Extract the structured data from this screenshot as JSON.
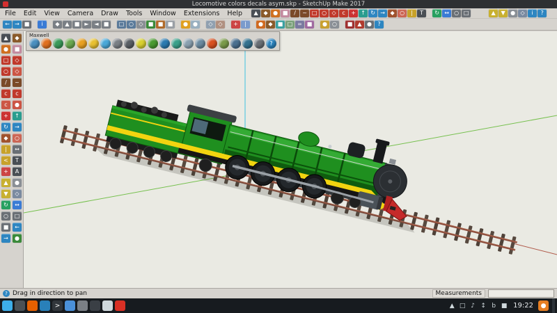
{
  "title_bar": {
    "title": "Locomotive colors decals asym.skp - SketchUp Make 2017"
  },
  "menu_bar": {
    "items": [
      "File",
      "Edit",
      "View",
      "Camera",
      "Draw",
      "Tools",
      "Window",
      "Extensions",
      "Help"
    ]
  },
  "toolbar_row1": {
    "icons": [
      {
        "name": "select-tool-icon",
        "glyph": "▲",
        "color": "#4a4f55"
      },
      {
        "name": "make-component-icon",
        "glyph": "◆",
        "color": "#8a5a2a"
      },
      {
        "name": "paint-bucket-icon",
        "glyph": "●",
        "color": "#d07020"
      },
      {
        "name": "eraser-icon",
        "glyph": "■",
        "color": "#c48ca0"
      },
      {
        "name": "line-tool-icon",
        "glyph": "/",
        "color": "#7a4a28"
      },
      {
        "name": "freehand-tool-icon",
        "glyph": "~",
        "color": "#7a4a28"
      },
      {
        "name": "rectangle-tool-icon",
        "glyph": "□",
        "color": "#c0392b"
      },
      {
        "name": "circle-tool-icon",
        "glyph": "○",
        "color": "#c0392b"
      },
      {
        "name": "polygon-tool-icon",
        "glyph": "◇",
        "color": "#c0392b"
      },
      {
        "name": "arc-tool-icon",
        "glyph": "c",
        "color": "#c0392b"
      },
      {
        "name": "move-tool-icon",
        "glyph": "+",
        "color": "#cc3333"
      },
      {
        "name": "push-pull-tool-icon",
        "glyph": "↑",
        "color": "#2a9d8f"
      },
      {
        "name": "rotate-tool-icon",
        "glyph": "↻",
        "color": "#2e86c1"
      },
      {
        "name": "follow-me-tool-icon",
        "glyph": "→",
        "color": "#2e86c1"
      },
      {
        "name": "scale-tool-icon",
        "glyph": "◆",
        "color": "#a0522d"
      },
      {
        "name": "offset-tool-icon",
        "glyph": "○",
        "color": "#cc6655"
      },
      {
        "name": "tape-measure-icon",
        "glyph": "|",
        "color": "#c8a22a"
      },
      {
        "name": "text-tool-icon",
        "glyph": "T",
        "color": "#4a4f55"
      },
      {
        "name": "orbit-tool-icon",
        "glyph": "↻",
        "color": "#27a060",
        "gap": true
      },
      {
        "name": "pan-tool-icon",
        "glyph": "↔",
        "color": "#3a7bd5"
      },
      {
        "name": "zoom-tool-icon",
        "glyph": "○",
        "color": "#6a6f75"
      },
      {
        "name": "zoom-extents-icon",
        "glyph": "□",
        "color": "#6a6f75"
      }
    ]
  },
  "toolbar_row1_right": {
    "icons": [
      {
        "name": "position-camera-icon",
        "glyph": "▲",
        "color": "#c8b030"
      },
      {
        "name": "walk-tool-icon",
        "glyph": "▼",
        "color": "#c8b030"
      },
      {
        "name": "look-around-icon",
        "glyph": "●",
        "color": "#8a8f95"
      },
      {
        "name": "section-plane-icon",
        "glyph": "◇",
        "color": "#7a8aa0"
      },
      {
        "name": "model-info-icon",
        "glyph": "i",
        "color": "#2e86c1"
      },
      {
        "name": "instructor-icon",
        "glyph": "?",
        "color": "#2e86c1"
      }
    ]
  },
  "toolbar_row2": {
    "icons": [
      {
        "name": "undo-icon",
        "glyph": "←",
        "color": "#2e86c1"
      },
      {
        "name": "redo-icon",
        "glyph": "→",
        "color": "#2e86c1"
      },
      {
        "name": "print-icon",
        "glyph": "■",
        "color": "#6a6f75"
      },
      {
        "name": "entity-info-icon",
        "glyph": "i",
        "color": "#3a7bd5",
        "gap": true
      },
      {
        "name": "iso-view-icon",
        "glyph": "◆",
        "color": "#7a7f85",
        "gap": true
      },
      {
        "name": "top-view-icon",
        "glyph": "▲",
        "color": "#7a7f85"
      },
      {
        "name": "front-view-icon",
        "glyph": "■",
        "color": "#7a7f85"
      },
      {
        "name": "right-view-icon",
        "glyph": "►",
        "color": "#7a7f85"
      },
      {
        "name": "back-view-icon",
        "glyph": "◄",
        "color": "#7a7f85"
      },
      {
        "name": "left-view-icon",
        "glyph": "■",
        "color": "#7a7f85"
      },
      {
        "name": "xray-mode-icon",
        "glyph": "□",
        "color": "#5a7a9a",
        "gap": true
      },
      {
        "name": "wireframe-mode-icon",
        "glyph": "○",
        "color": "#5a7a9a"
      },
      {
        "name": "hidden-line-mode-icon",
        "glyph": "◇",
        "color": "#8a8f95"
      },
      {
        "name": "shaded-mode-icon",
        "glyph": "■",
        "color": "#3a8a3a"
      },
      {
        "name": "textured-mode-icon",
        "glyph": "■",
        "color": "#b06a2a"
      },
      {
        "name": "monochrome-mode-icon",
        "glyph": "■",
        "color": "#9a9fa5"
      },
      {
        "name": "shadows-toggle-icon",
        "glyph": "●",
        "color": "#e0a020",
        "gap": true
      },
      {
        "name": "fog-toggle-icon",
        "glyph": "●",
        "color": "#9ab0c0"
      },
      {
        "name": "section-plane-toggle-icon",
        "glyph": "◇",
        "color": "#90a0b0",
        "gap": true
      },
      {
        "name": "section-cut-toggle-icon",
        "glyph": "◇",
        "color": "#b09080"
      },
      {
        "name": "axes-toggle-icon",
        "glyph": "+",
        "color": "#cc4444",
        "gap": true
      },
      {
        "name": "guides-toggle-icon",
        "glyph": "|",
        "color": "#7a9acc"
      },
      {
        "name": "materials-browser-icon",
        "glyph": "●",
        "color": "#d06a20",
        "gap": true
      },
      {
        "name": "components-browser-icon",
        "glyph": "◆",
        "color": "#8a5a2a"
      },
      {
        "name": "styles-browser-icon",
        "glyph": "■",
        "color": "#3aa0a0"
      },
      {
        "name": "layers-panel-icon",
        "glyph": "□",
        "color": "#7aa07a"
      },
      {
        "name": "outliner-panel-icon",
        "glyph": "=",
        "color": "#7a7aa0"
      },
      {
        "name": "scenes-panel-icon",
        "glyph": "■",
        "color": "#a06aa0"
      },
      {
        "name": "shadow-settings-icon",
        "glyph": "●",
        "color": "#c8a030",
        "gap": true
      },
      {
        "name": "soften-edges-icon",
        "glyph": "○",
        "color": "#8a8f95"
      },
      {
        "name": "extension-warehouse-icon",
        "glyph": "■",
        "color": "#a03030",
        "gap": true
      },
      {
        "name": "warehouse-3d-icon",
        "glyph": "▲",
        "color": "#b03a2e"
      },
      {
        "name": "preferences-icon",
        "glyph": "●",
        "color": "#6a6f75"
      },
      {
        "name": "help-center-icon",
        "glyph": "?",
        "color": "#2e86c1"
      }
    ]
  },
  "maxwell": {
    "title": "Maxwell",
    "icons": [
      {
        "name": "maxwell-scene-icon",
        "glyph": "",
        "color": "#4a8fbf"
      },
      {
        "name": "maxwell-render-icon",
        "glyph": "",
        "color": "#e07020"
      },
      {
        "name": "maxwell-materials-icon",
        "glyph": "",
        "color": "#3a9a5a"
      },
      {
        "name": "maxwell-textures-icon",
        "glyph": "",
        "color": "#6aa84f"
      },
      {
        "name": "maxwell-cloud-icon",
        "glyph": "",
        "color": "#e8a020"
      },
      {
        "name": "maxwell-sun-icon",
        "glyph": "",
        "color": "#e8c030"
      },
      {
        "name": "maxwell-sky-icon",
        "glyph": "",
        "color": "#4aa8d8"
      },
      {
        "name": "maxwell-camera-icon",
        "glyph": "",
        "color": "#7a7f85"
      },
      {
        "name": "maxwell-lens-icon",
        "glyph": "",
        "color": "#5a5f65"
      },
      {
        "name": "maxwell-emitter-icon",
        "glyph": "",
        "color": "#d8d030"
      },
      {
        "name": "maxwell-grass-icon",
        "glyph": "",
        "color": "#4a9a30"
      },
      {
        "name": "maxwell-sea-icon",
        "glyph": "",
        "color": "#2a7ab0"
      },
      {
        "name": "maxwell-scatter-icon",
        "glyph": "",
        "color": "#3aa08a"
      },
      {
        "name": "maxwell-volumetric-icon",
        "glyph": "",
        "color": "#8aa0b0"
      },
      {
        "name": "maxwell-particles-icon",
        "glyph": "",
        "color": "#6a8aa0"
      },
      {
        "name": "maxwell-fire-icon",
        "glyph": "",
        "color": "#d85020"
      },
      {
        "name": "maxwell-referenced-icon",
        "glyph": "",
        "color": "#7a9a4a"
      },
      {
        "name": "maxwell-network-icon",
        "glyph": "",
        "color": "#4a6f8f"
      },
      {
        "name": "maxwell-studio-icon",
        "glyph": "",
        "color": "#35728f"
      },
      {
        "name": "maxwell-settings-icon",
        "glyph": "",
        "color": "#6a6f75"
      },
      {
        "name": "maxwell-help-icon",
        "glyph": "?",
        "color": "#2e86c1"
      }
    ]
  },
  "left_toolbar": {
    "icons": [
      {
        "name": "select-icon",
        "glyph": "▲",
        "color": "#4a4f55"
      },
      {
        "name": "make-component-icon",
        "glyph": "◆",
        "color": "#8a5a2a"
      },
      {
        "name": "paint-bucket-icon",
        "glyph": "●",
        "color": "#d07020"
      },
      {
        "name": "eraser-icon",
        "glyph": "■",
        "color": "#c48ca0"
      },
      {
        "name": "rectangle-icon",
        "glyph": "□",
        "color": "#c0392b"
      },
      {
        "name": "rotated-rectangle-icon",
        "glyph": "◇",
        "color": "#c0392b"
      },
      {
        "name": "circle-icon",
        "glyph": "○",
        "color": "#c0392b"
      },
      {
        "name": "polygon-icon",
        "glyph": "◇",
        "color": "#cc5544"
      },
      {
        "name": "line-icon",
        "glyph": "/",
        "color": "#7a4a28"
      },
      {
        "name": "freehand-icon",
        "glyph": "~",
        "color": "#7a4a28"
      },
      {
        "name": "arc-icon",
        "glyph": "c",
        "color": "#c0392b"
      },
      {
        "name": "two-point-arc-icon",
        "glyph": "c",
        "color": "#c0392b"
      },
      {
        "name": "three-point-arc-icon",
        "glyph": "c",
        "color": "#cc5544"
      },
      {
        "name": "pie-icon",
        "glyph": "●",
        "color": "#cc5544"
      },
      {
        "name": "move-icon",
        "glyph": "+",
        "color": "#cc3333"
      },
      {
        "name": "push-pull-icon",
        "glyph": "↑",
        "color": "#2a9d8f"
      },
      {
        "name": "rotate-icon",
        "glyph": "↻",
        "color": "#2e86c1"
      },
      {
        "name": "follow-me-icon",
        "glyph": "→",
        "color": "#2e86c1"
      },
      {
        "name": "scale-icon",
        "glyph": "◆",
        "color": "#a0522d"
      },
      {
        "name": "offset-icon",
        "glyph": "○",
        "color": "#cc6655"
      },
      {
        "name": "tape-measure-icon",
        "glyph": "|",
        "color": "#c8a22a"
      },
      {
        "name": "dimension-icon",
        "glyph": "↔",
        "color": "#6a6f75"
      },
      {
        "name": "protractor-icon",
        "glyph": "<",
        "color": "#c8a22a"
      },
      {
        "name": "text-icon",
        "glyph": "T",
        "color": "#4a4f55"
      },
      {
        "name": "axes-icon",
        "glyph": "+",
        "color": "#cc4444"
      },
      {
        "name": "text-3d-icon",
        "glyph": "A",
        "color": "#4a4f55"
      },
      {
        "name": "position-camera-icon",
        "glyph": "▲",
        "color": "#c8b030"
      },
      {
        "name": "look-around-icon",
        "glyph": "●",
        "color": "#8a8f95"
      },
      {
        "name": "walk-icon",
        "glyph": "▼",
        "color": "#c8b030"
      },
      {
        "name": "section-plane-icon",
        "glyph": "◇",
        "color": "#7a8aa0"
      },
      {
        "name": "orbit-icon",
        "glyph": "↻",
        "color": "#27a060"
      },
      {
        "name": "pan-icon",
        "glyph": "↔",
        "color": "#3a7bd5"
      },
      {
        "name": "zoom-icon",
        "glyph": "○",
        "color": "#6a6f75"
      },
      {
        "name": "zoom-window-icon",
        "glyph": "□",
        "color": "#6a6f75"
      },
      {
        "name": "zoom-extents-icon",
        "glyph": "■",
        "color": "#6a6f75"
      },
      {
        "name": "previous-view-icon",
        "glyph": "←",
        "color": "#2e86c1"
      },
      {
        "name": "next-view-icon",
        "glyph": "→",
        "color": "#2e86c1"
      },
      {
        "name": "add-location-icon",
        "glyph": "●",
        "color": "#3a8a3a"
      }
    ]
  },
  "status_bar": {
    "hint": "Drag in direction to pan",
    "measurements_label": "Measurements",
    "measurements_value": ""
  },
  "taskbar": {
    "left_icons": [
      {
        "name": "app-launcher-icon",
        "glyph": "",
        "color": "#3daee9"
      },
      {
        "name": "desktop-pager-icon",
        "glyph": "",
        "color": "#4a5055"
      },
      {
        "name": "firefox-icon",
        "glyph": "",
        "color": "#e66000"
      },
      {
        "name": "file-manager-icon",
        "glyph": "",
        "color": "#2980b9"
      },
      {
        "name": "konsole-icon",
        "glyph": ">",
        "color": "#31363b"
      },
      {
        "name": "kate-icon",
        "glyph": "",
        "color": "#4a90d9"
      },
      {
        "name": "gimp-icon",
        "glyph": "",
        "color": "#7a7f85"
      },
      {
        "name": "inkscape-icon",
        "glyph": "",
        "color": "#3a3f45"
      },
      {
        "name": "libreoffice-icon",
        "glyph": "",
        "color": "#cfd8dc",
        "fg": "#333333"
      },
      {
        "name": "sketchup-taskbar-icon",
        "glyph": "",
        "color": "#d93025"
      }
    ],
    "tray_icons": [
      {
        "name": "show-hidden-icon",
        "glyph": "▲",
        "color": "transparent",
        "fg": "#cfd8dc"
      },
      {
        "name": "clipboard-icon",
        "glyph": "□",
        "color": "transparent",
        "fg": "#cfd8dc"
      },
      {
        "name": "volume-icon",
        "glyph": "♪",
        "color": "transparent",
        "fg": "#cfd8dc"
      },
      {
        "name": "network-icon",
        "glyph": "↕",
        "color": "transparent",
        "fg": "#cfd8dc"
      },
      {
        "name": "bluetooth-icon",
        "glyph": "b",
        "color": "transparent",
        "fg": "#cfd8dc"
      },
      {
        "name": "display-icon",
        "glyph": "■",
        "color": "transparent",
        "fg": "#cfd8dc"
      }
    ],
    "right_icons": [
      {
        "name": "notifications-icon",
        "glyph": "●",
        "color": "#e67e22"
      }
    ],
    "clock": "19:22"
  }
}
